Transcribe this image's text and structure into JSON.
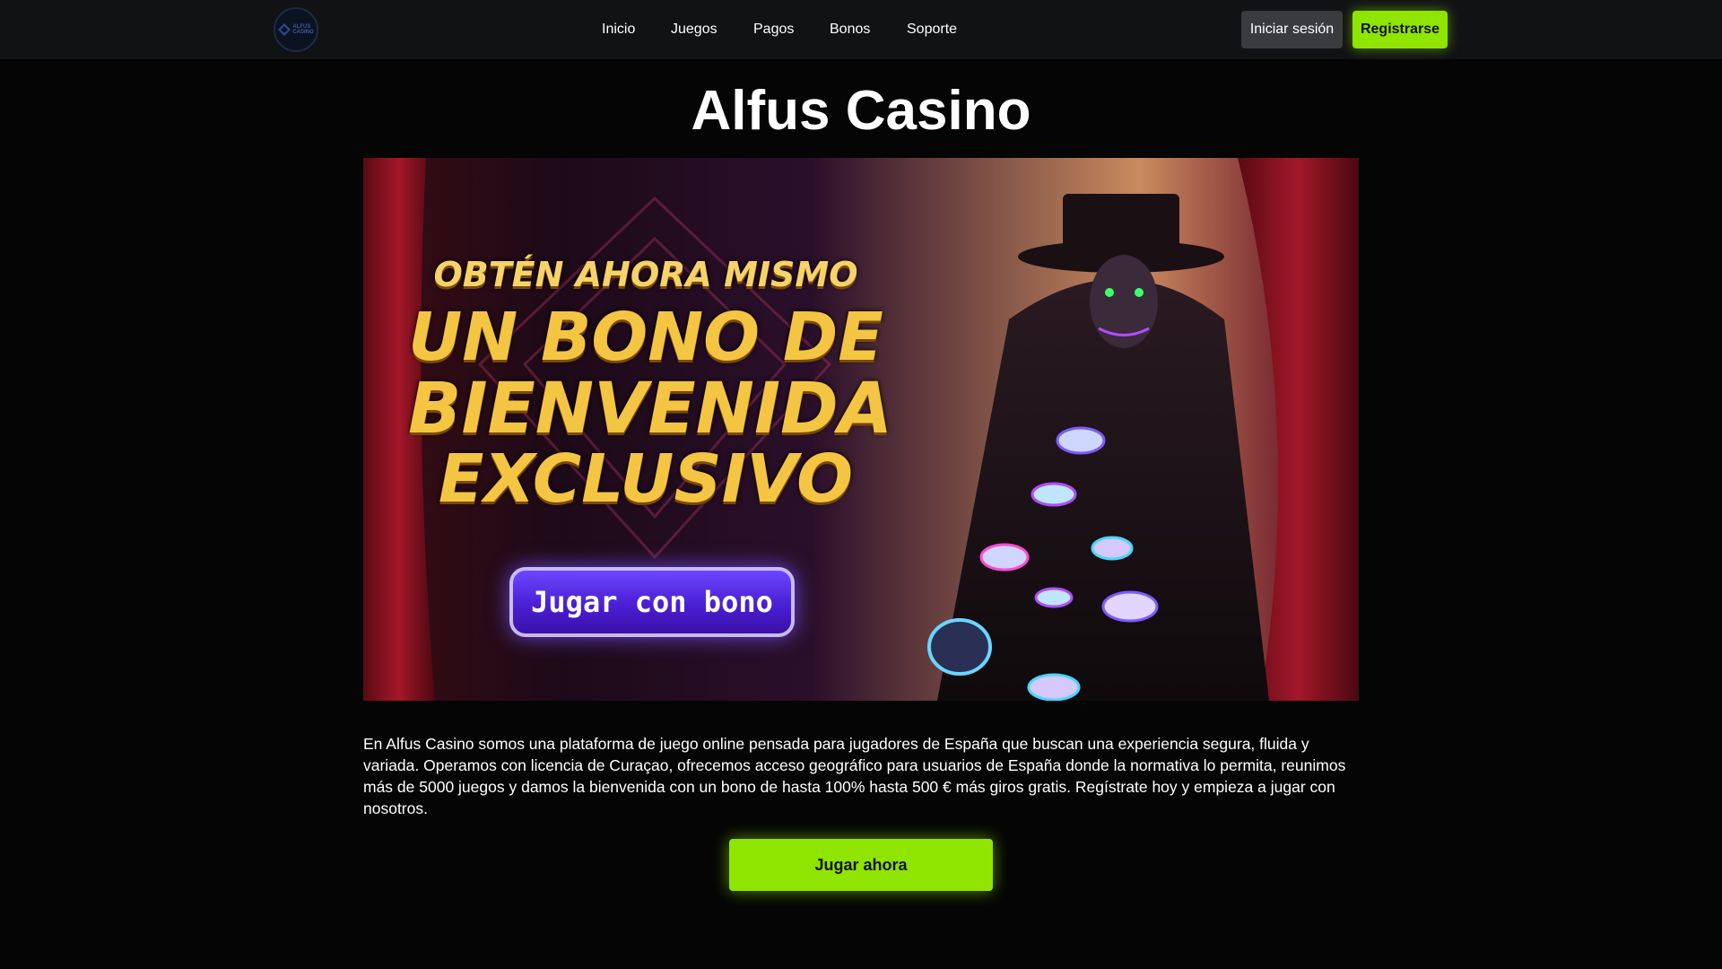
{
  "header": {
    "logo_text": [
      "ALFUS",
      "CASINO"
    ],
    "nav": [
      "Inicio",
      "Juegos",
      "Pagos",
      "Bonos",
      "Soporte"
    ],
    "login_label": "Iniciar sesión",
    "register_label": "Registrarse"
  },
  "main": {
    "title": "Alfus Casino",
    "banner": {
      "line1": "OBTÉN AHORA MISMO",
      "line2": "UN BONO DE",
      "line3": "BIENVENIDA",
      "line4": "EXCLUSIVO",
      "button_label": "Jugar con bono"
    },
    "description": "En Alfus Casino somos una plataforma de juego online pensada para jugadores de España que buscan una experiencia segura, fluida y variada. Operamos con licencia de Curaçao, ofrecemos acceso geográfico para usuarios de España donde la normativa lo permita, reunimos más de 5000 juegos y damos la bienvenida con un bono de hasta 100% hasta 500 € más giros gratis. Regístrate hoy y empieza a jugar con nosotros.",
    "play_label": "Jugar ahora"
  },
  "colors": {
    "accent": "#8fe400",
    "background": "#050505",
    "header_bg": "#111214",
    "banner_button": "#4a1fd4"
  }
}
